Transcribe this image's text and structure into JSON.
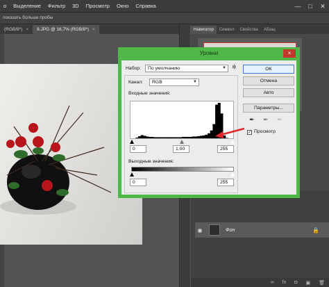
{
  "menubar": {
    "items": [
      "о",
      "Выделение",
      "Фильтр",
      "3D",
      "Просмотр",
      "Окно",
      "Справка"
    ]
  },
  "options_bar": {
    "hint": "показать больше пробы"
  },
  "document_tabs": [
    {
      "label": "(RGB/8*)",
      "close": "×"
    },
    {
      "label": "8.JPG @ 16,7% (RGB/8*)",
      "close": "×"
    }
  ],
  "panel_tabs": [
    "Навигатор",
    "Символ",
    "Свойства",
    "Абзац"
  ],
  "layers": {
    "layer_name": "Фон",
    "visibility_icon": "eye-icon",
    "lock_icon": "lock-icon"
  },
  "dialog": {
    "title": "Уровни",
    "close": "×",
    "preset_label": "Набор:",
    "preset_value": "По умолчанию",
    "channel_label": "Канал:",
    "channel_value": "RGB",
    "input_label": "Входные значения:",
    "input_black": "0",
    "input_gamma": "1,00",
    "input_white": "255",
    "output_label": "Выходные значения:",
    "output_black": "0",
    "output_white": "255",
    "buttons": {
      "ok": "OK",
      "cancel": "Отмена",
      "auto": "Авто",
      "options": "Параметры..."
    },
    "preview_label": "Просмотр",
    "preview_checked": "✓"
  },
  "colors": {
    "dialog_frame": "#4fb848",
    "arrow": "#e0262a",
    "app_bg": "#535353"
  },
  "histogram": {
    "levels": [
      0,
      0,
      2,
      6,
      9,
      7,
      5,
      4,
      4,
      3,
      3,
      3,
      3,
      3,
      3,
      3,
      3,
      3,
      3,
      3,
      4,
      4,
      4,
      4,
      5,
      5,
      6,
      7,
      8,
      10,
      14,
      22,
      40,
      95,
      100,
      70,
      8,
      1,
      0,
      0
    ]
  }
}
